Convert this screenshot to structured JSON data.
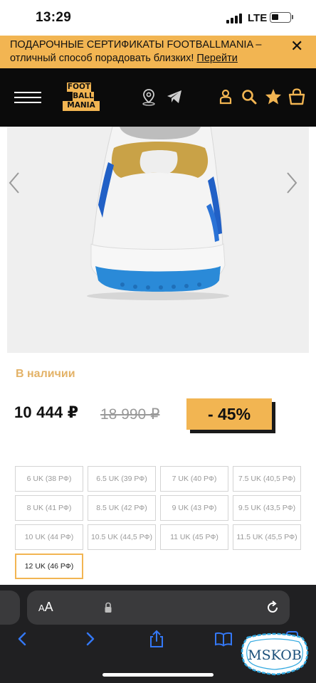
{
  "status": {
    "time": "13:29",
    "network": "LTE"
  },
  "promo": {
    "text": "ПОДАРОЧНЫЕ СЕРТИФИКАТЫ FOOTBALLMANIA – отличный способ порадовать близких!",
    "link": "Перейти",
    "close": "✕"
  },
  "header": {
    "logo": {
      "line1": "FOOT",
      "line2": "BALL",
      "line3": "MANIA"
    },
    "icons": [
      "menu-icon",
      "location-pin-icon",
      "telegram-icon",
      "user-icon",
      "search-icon",
      "star-icon",
      "cart-icon"
    ]
  },
  "product": {
    "availability": "В наличии",
    "price": "10 444 ₽",
    "old_price": "18 990 ₽",
    "discount": "- 45%",
    "sizes": [
      {
        "label": "6 UK (38 РФ)",
        "selected": false
      },
      {
        "label": "6.5 UK (39 РФ)",
        "selected": false
      },
      {
        "label": "7 UK (40 РФ)",
        "selected": false
      },
      {
        "label": "7.5 UK (40,5 РФ)",
        "selected": false
      },
      {
        "label": "8 UK (41 РФ)",
        "selected": false
      },
      {
        "label": "8.5 UK (42 РФ)",
        "selected": false
      },
      {
        "label": "9 UK (43 РФ)",
        "selected": false
      },
      {
        "label": "9.5 UK (43,5 РФ)",
        "selected": false
      },
      {
        "label": "10 UK (44 РФ)",
        "selected": false
      },
      {
        "label": "10.5 UK (44,5 РФ)",
        "selected": false
      },
      {
        "label": "11 UK (45 РФ)",
        "selected": false
      },
      {
        "label": "11.5 UK (45,5 РФ)",
        "selected": false
      },
      {
        "label": "12 UK (46 РФ)",
        "selected": true
      }
    ]
  },
  "safari": {
    "text_size": {
      "small": "A",
      "large": "A"
    }
  },
  "watermark": {
    "text": "MSKOB"
  },
  "colors": {
    "accent": "#f2b552",
    "availability": "#e3b267",
    "header_bg": "#0b0b0b",
    "safari_bg": "#202022",
    "safari_blue": "#3478f6"
  }
}
